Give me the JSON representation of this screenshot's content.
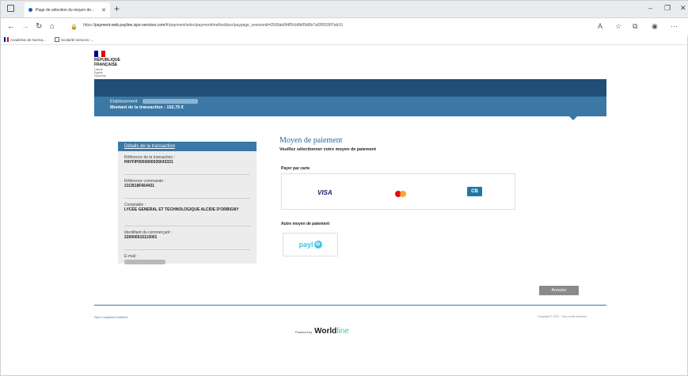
{
  "browser": {
    "tab_title": "Page de sélection du moyen de...",
    "tab_close": "✕",
    "new_tab": "+",
    "minimize": "–",
    "restore": "❐",
    "close": "✕",
    "url_prefix": "https://",
    "url_host": "payment-web.payline.sips-services.com",
    "url_rest": "/fr/payment/selectpayment/method/pxv/paypage_sessionid=0569ab0f4f5fcb8bf0fd6b7af2f0039f7eb16",
    "favorites": [
      "Académie de Norma...",
      "Scolarité services -..."
    ]
  },
  "brand": {
    "title_lines": [
      "RÉPUBLIQUE",
      "FRANÇAISE"
    ],
    "motto_lines": [
      "Liberté",
      "Égalité",
      "Fraternité"
    ],
    "flag_colors": [
      "#000091",
      "#ffffff",
      "#e1000f"
    ]
  },
  "header": {
    "merchant_label": "Etablissement :",
    "amount_label": "Montant de la transaction :",
    "amount_value": "152,75 €"
  },
  "details": {
    "title": "Détails de la transaction",
    "items": [
      {
        "label": "Référence de la transaction :",
        "value": "PAYFIP0000000035643331"
      },
      {
        "label": "Référence commande :",
        "value": "21CB18F664431"
      },
      {
        "label": "Comptable :",
        "value": "LYCEE GENERAL ET TECHNOLOGIQUE ALCIDE D'ORBIGNY"
      },
      {
        "label": "Identifiant du commerçant :",
        "value": "220000515110001"
      },
      {
        "label": "E-mail :",
        "value": ""
      }
    ]
  },
  "payment": {
    "title": "Moyen de paiement",
    "subtitle": "Veuillez sélectionner votre moyen de paiement",
    "card_section": "Payer par carte",
    "cards": {
      "visa": "VISA",
      "cb": "CB"
    },
    "other_section": "Autre moyen de paiement",
    "paylib": "payl",
    "paylib_badge": "ib"
  },
  "actions": {
    "cancel": "Annuler"
  },
  "footer": {
    "left": "Sips e-payment solution",
    "powered": "Powered by",
    "worldline_a": "World",
    "worldline_b": "line",
    "copyright": "Copyright © 2022 - Tous droits réservés"
  }
}
